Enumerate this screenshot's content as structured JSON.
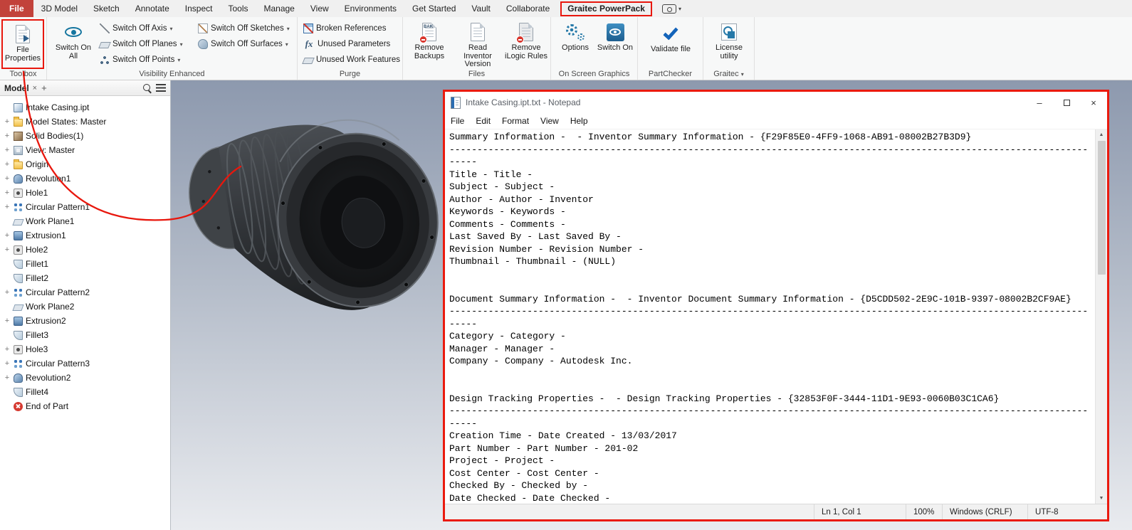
{
  "menubar": {
    "items": [
      "File",
      "3D Model",
      "Sketch",
      "Annotate",
      "Inspect",
      "Tools",
      "Manage",
      "View",
      "Environments",
      "Get Started",
      "Vault",
      "Collaborate",
      "Graitec PowerPack"
    ]
  },
  "ribbon": {
    "groups": {
      "toolbox": {
        "label": "Toolbox",
        "file_properties": "File Properties"
      },
      "visibility": {
        "label": "Visibility Enhanced",
        "switch_on_all": "Switch On All",
        "off_axis": "Switch Off Axis",
        "off_planes": "Switch Off Planes",
        "off_points": "Switch Off Points",
        "off_sketches": "Switch Off Sketches",
        "off_surfaces": "Switch Off Surfaces"
      },
      "purge": {
        "label": "Purge",
        "broken_references": "Broken References",
        "unused_parameters": "Unused Parameters",
        "unused_work_features": "Unused Work Features"
      },
      "files": {
        "label": "Files",
        "remove_backups": "Remove Backups",
        "read_inventor_version": "Read Inventor Version",
        "remove_ilogic_rules": "Remove iLogic Rules"
      },
      "on_screen_graphics": {
        "label": "On Screen Graphics",
        "options": "Options",
        "switch_on": "Switch On"
      },
      "partchecker": {
        "label": "PartChecker",
        "validate_file": "Validate file"
      },
      "graitec": {
        "label": "Graitec",
        "license_utility": "License utility"
      }
    }
  },
  "browser": {
    "tab": "Model",
    "tree": [
      {
        "label": "Intake Casing.ipt"
      },
      {
        "label": "Model States: Master"
      },
      {
        "label": "Solid Bodies(1)"
      },
      {
        "label": "View: Master"
      },
      {
        "label": "Origin"
      },
      {
        "label": "Revolution1"
      },
      {
        "label": "Hole1"
      },
      {
        "label": "Circular Pattern1"
      },
      {
        "label": "Work Plane1"
      },
      {
        "label": "Extrusion1"
      },
      {
        "label": "Hole2"
      },
      {
        "label": "Fillet1"
      },
      {
        "label": "Fillet2"
      },
      {
        "label": "Circular Pattern2"
      },
      {
        "label": "Work Plane2"
      },
      {
        "label": "Extrusion2"
      },
      {
        "label": "Fillet3"
      },
      {
        "label": "Hole3"
      },
      {
        "label": "Circular Pattern3"
      },
      {
        "label": "Revolution2"
      },
      {
        "label": "Fillet4"
      },
      {
        "label": "End of Part"
      }
    ]
  },
  "notepad": {
    "title": "Intake Casing.ipt.txt - Notepad",
    "menu": [
      "File",
      "Edit",
      "Format",
      "View",
      "Help"
    ],
    "content": "Summary Information -  - Inventor Summary Information - {F29F85E0-4FF9-1068-AB91-08002B27B3D9}\n-------------------------------------------------------------------------------------------------------------------\n-----\nTitle - Title - \nSubject - Subject - \nAuthor - Author - Inventor\nKeywords - Keywords - \nComments - Comments - \nLast Saved By - Last Saved By - \nRevision Number - Revision Number - \nThumbnail - Thumbnail - (NULL)\n\n\nDocument Summary Information -  - Inventor Document Summary Information - {D5CDD502-2E9C-101B-9397-08002B2CF9AE}\n-------------------------------------------------------------------------------------------------------------------\n-----\nCategory - Category - \nManager - Manager - \nCompany - Company - Autodesk Inc.\n\n\nDesign Tracking Properties -  - Design Tracking Properties - {32853F0F-3444-11D1-9E93-0060B03C1CA6}\n-------------------------------------------------------------------------------------------------------------------\n-----\nCreation Time - Date Created - 13/03/2017\nPart Number - Part Number - 201-02\nProject - Project - \nCost Center - Cost Center - \nChecked By - Checked by - \nDate Checked - Date Checked - ",
    "status": {
      "cursor": "Ln 1, Col 1",
      "zoom": "100%",
      "line_ending": "Windows (CRLF)",
      "encoding": "UTF-8"
    }
  },
  "icons": {
    "caret_down": "▾",
    "plus_expander": "+",
    "tab_close": "×",
    "tab_add": "+",
    "minimize": "–",
    "close": "×",
    "scroll_up": "▲",
    "scroll_down": "▼",
    "fx": "fx",
    "bak": "BAK"
  },
  "colors": {
    "annotation_red": "#e8170d",
    "file_tab_red": "#c2423b",
    "accent_blue": "#15759f"
  }
}
